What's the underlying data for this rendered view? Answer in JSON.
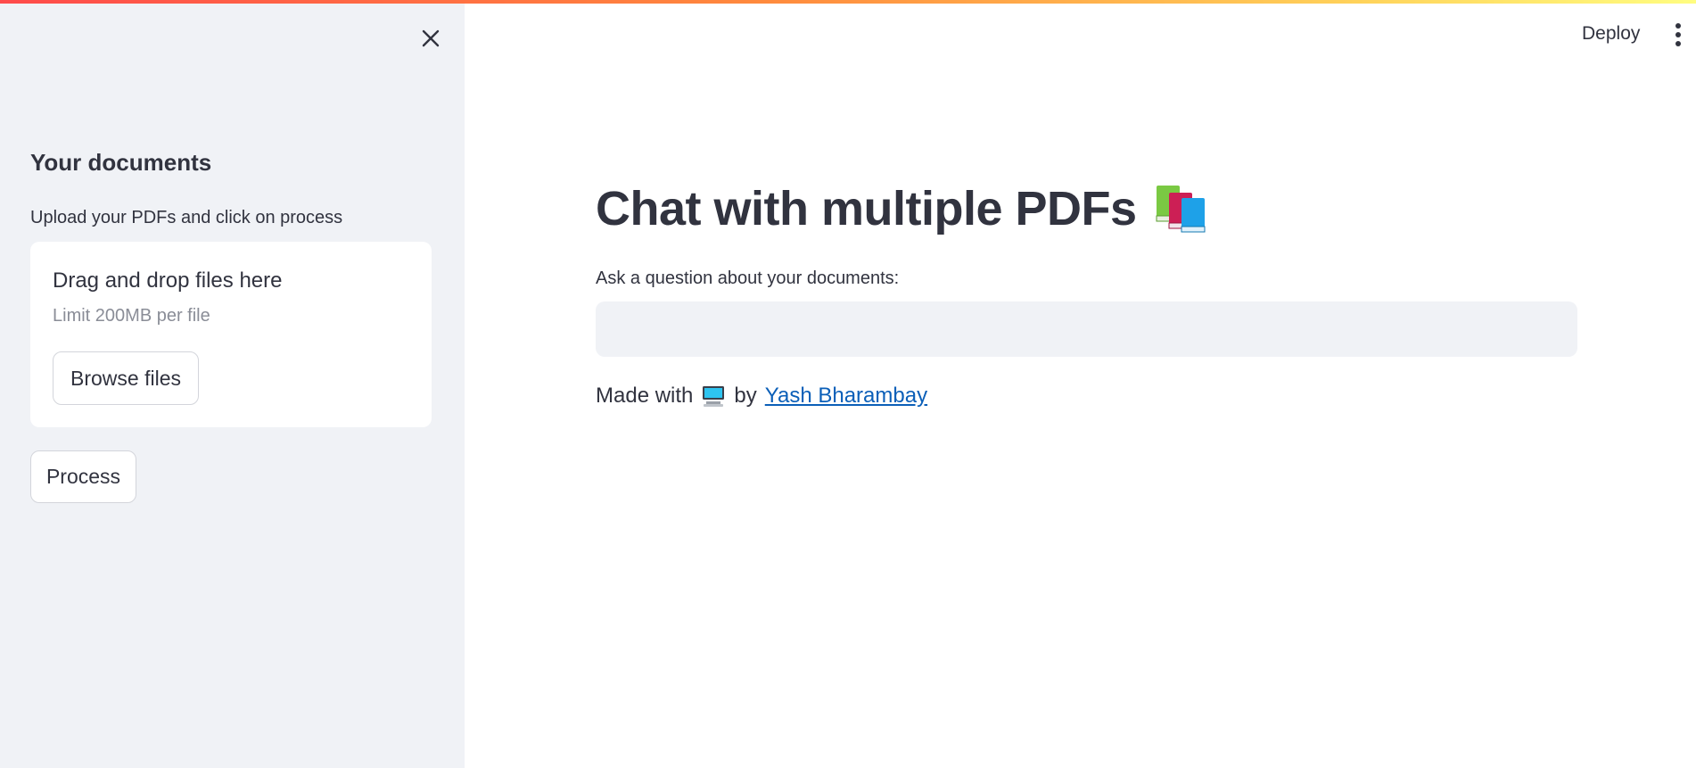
{
  "sidebar": {
    "heading": "Your documents",
    "caption": "Upload your PDFs and click on process",
    "uploader": {
      "drop_text": "Drag and drop files here",
      "limit_text": "Limit 200MB per file",
      "browse_label": "Browse files"
    },
    "process_label": "Process",
    "close_icon": "close-icon"
  },
  "header": {
    "deploy_label": "Deploy",
    "menu_icon": "vertical-ellipsis-icon"
  },
  "main": {
    "title": "Chat with multiple PDFs",
    "title_icon": "books-icon",
    "question_label": "Ask a question about your documents:",
    "question_value": "",
    "footer": {
      "prefix": "Made with",
      "icon": "computer-icon",
      "by": "by",
      "author_link": "Yash Bharambay"
    }
  },
  "colors": {
    "sidebar_bg": "#f0f2f6",
    "text": "#31333f",
    "link": "#0b5fb8",
    "accent_red": "#ff4b4b"
  }
}
